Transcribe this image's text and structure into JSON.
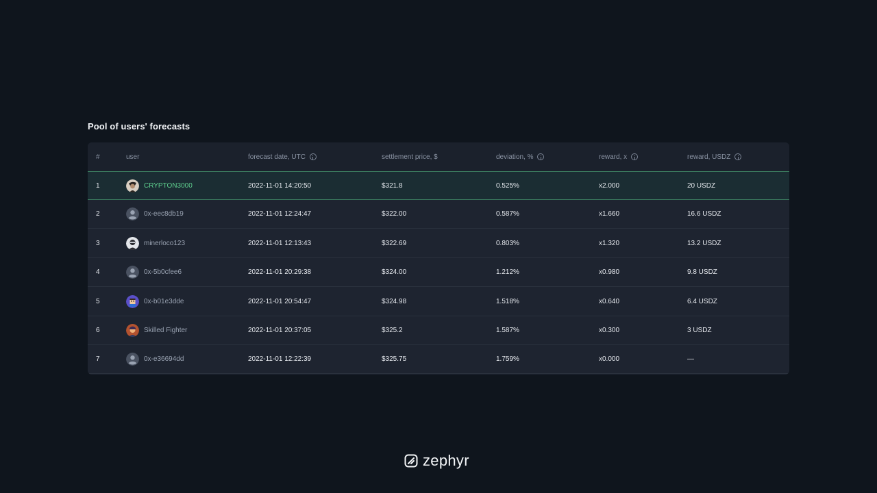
{
  "section": {
    "title": "Pool of users' forecasts"
  },
  "table": {
    "columns": [
      {
        "label": "#",
        "info": false
      },
      {
        "label": "user",
        "info": false
      },
      {
        "label": "forecast date, UTC",
        "info": true
      },
      {
        "label": "settlement price, $",
        "info": false
      },
      {
        "label": "deviation, %",
        "info": true
      },
      {
        "label": "reward, x",
        "info": true
      },
      {
        "label": "reward, USDZ",
        "info": true
      }
    ],
    "rows": [
      {
        "rank": "1",
        "user": "CRYPTON3000",
        "avatar": "crypto-avatar-icon",
        "date": "2022-11-01 14:20:50",
        "price": "$321.8",
        "deviation": "0.525%",
        "reward_x": "x2.000",
        "reward_usdz": "20 USDZ",
        "highlight": true
      },
      {
        "rank": "2",
        "user": "0x-eec8db19",
        "avatar": "default-user-icon",
        "date": "2022-11-01 12:24:47",
        "price": "$322.00",
        "deviation": "0.587%",
        "reward_x": "x1.660",
        "reward_usdz": "16.6 USDZ",
        "highlight": false
      },
      {
        "rank": "3",
        "user": "minerloco123",
        "avatar": "masked-avatar-icon",
        "date": "2022-11-01 12:13:43",
        "price": "$322.69",
        "deviation": "0.803%",
        "reward_x": "x1.320",
        "reward_usdz": "13.2 USDZ",
        "highlight": false
      },
      {
        "rank": "4",
        "user": "0x-5b0cfee6",
        "avatar": "default-user-icon",
        "date": "2022-11-01 20:29:38",
        "price": "$324.00",
        "deviation": "1.212%",
        "reward_x": "x0.980",
        "reward_usdz": "9.8 USDZ",
        "highlight": false
      },
      {
        "rank": "5",
        "user": "0x-b01e3dde",
        "avatar": "pixel-avatar-icon",
        "date": "2022-11-01 20:54:47",
        "price": "$324.98",
        "deviation": "1.518%",
        "reward_x": "x0.640",
        "reward_usdz": "6.4 USDZ",
        "highlight": false
      },
      {
        "rank": "6",
        "user": "Skilled Fighter",
        "avatar": "fighter-avatar-icon",
        "date": "2022-11-01 20:37:05",
        "price": "$325.2",
        "deviation": "1.587%",
        "reward_x": "x0.300",
        "reward_usdz": "3 USDZ",
        "highlight": false
      },
      {
        "rank": "7",
        "user": "0x-e36694dd",
        "avatar": "default-user-icon",
        "date": "2022-11-01 12:22:39",
        "price": "$325.75",
        "deviation": "1.759%",
        "reward_x": "x0.000",
        "reward_usdz": "—",
        "highlight": false
      }
    ]
  },
  "footer": {
    "brand": "zephyr",
    "logo_icon": "zephyr-logo-icon"
  },
  "colors": {
    "background": "#0f151d",
    "table_bg": "#1e2430",
    "header_bg": "#1b212c",
    "highlight_bg": "#1b2d33",
    "highlight_border": "#3b7a5e",
    "highlight_user": "#5fd08f",
    "muted_text": "#8a93a3"
  }
}
